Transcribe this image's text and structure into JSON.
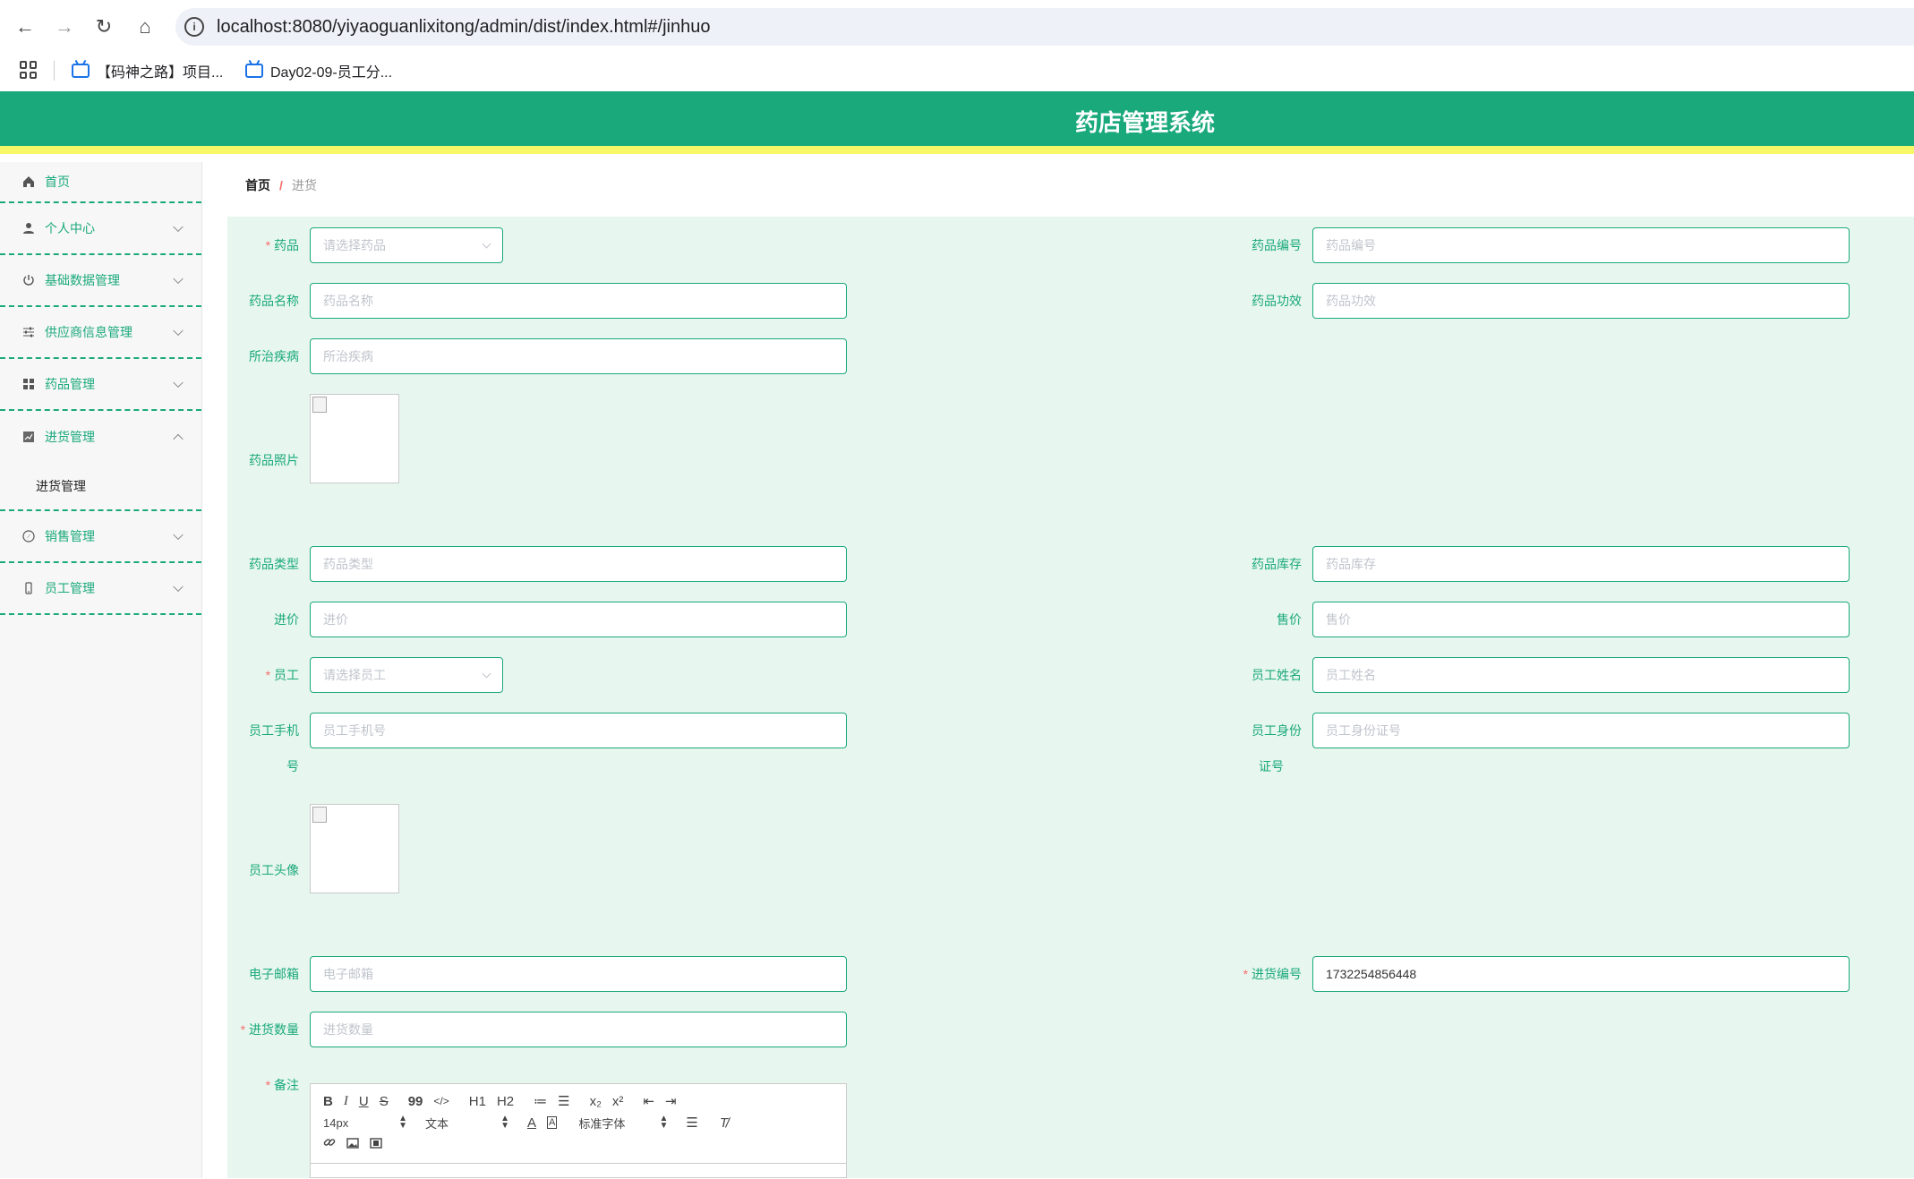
{
  "browser": {
    "url": "localhost:8080/yiyaoguanlixitong/admin/dist/index.html#/jinhuo",
    "bookmarks": [
      "【码神之路】项目...",
      "Day02-09-员工分..."
    ]
  },
  "header": {
    "title": "药店管理系统"
  },
  "sidebar": {
    "items": [
      {
        "label": "首页",
        "icon": "home-icon"
      },
      {
        "label": "个人中心",
        "icon": "user-icon"
      },
      {
        "label": "基础数据管理",
        "icon": "power-icon"
      },
      {
        "label": "供应商信息管理",
        "icon": "sliders-icon"
      },
      {
        "label": "药品管理",
        "icon": "grid-icon"
      },
      {
        "label": "进货管理",
        "icon": "chart-icon",
        "expanded": true,
        "children": [
          "进货管理"
        ]
      },
      {
        "label": "销售管理",
        "icon": "compass-icon"
      },
      {
        "label": "员工管理",
        "icon": "phone-icon"
      }
    ]
  },
  "breadcrumb": {
    "home": "首页",
    "separator": "/",
    "current": "进货"
  },
  "form": {
    "drug": {
      "label": "药品",
      "placeholder": "请选择药品"
    },
    "drug_code": {
      "label": "药品编号",
      "placeholder": "药品编号"
    },
    "drug_name": {
      "label": "药品名称",
      "placeholder": "药品名称"
    },
    "drug_effect": {
      "label": "药品功效",
      "placeholder": "药品功效"
    },
    "disease": {
      "label": "所治疾病",
      "placeholder": "所治疾病"
    },
    "drug_photo": {
      "label": "药品照片"
    },
    "drug_type": {
      "label": "药品类型",
      "placeholder": "药品类型"
    },
    "drug_stock": {
      "label": "药品库存",
      "placeholder": "药品库存"
    },
    "buy_price": {
      "label": "进价",
      "placeholder": "进价"
    },
    "sell_price": {
      "label": "售价",
      "placeholder": "售价"
    },
    "employee": {
      "label": "员工",
      "placeholder": "请选择员工"
    },
    "employee_name": {
      "label": "员工姓名",
      "placeholder": "员工姓名"
    },
    "employee_phone": {
      "label_line1": "员工手机",
      "label_line2": "号",
      "placeholder": "员工手机号"
    },
    "employee_id": {
      "label_line1": "员工身份",
      "label_line2": "证号",
      "placeholder": "员工身份证号"
    },
    "employee_avatar": {
      "label": "员工头像"
    },
    "email": {
      "label": "电子邮箱",
      "placeholder": "电子邮箱"
    },
    "purchase_no": {
      "label": "进货编号",
      "value": "1732254856448"
    },
    "purchase_qty": {
      "label": "进货数量",
      "placeholder": "进货数量"
    },
    "remark": {
      "label": "备注"
    }
  },
  "editor": {
    "row1": [
      "B",
      "I",
      "U",
      "S",
      "99",
      "</>",
      "H1",
      "H2",
      "≔",
      "☰",
      "x₂",
      "x²",
      "⇤",
      "⇥"
    ],
    "font_size": "14px",
    "block_type": "文本",
    "font_family": "标准字体"
  }
}
